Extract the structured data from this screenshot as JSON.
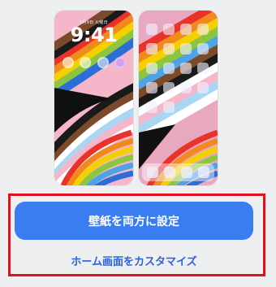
{
  "lock_screen": {
    "date": "1月9日 火曜日",
    "time": "9:41",
    "widgets": [
      "widget-circle",
      "widget-circle",
      "widget-circle",
      "widget-circle"
    ]
  },
  "home_screen": {
    "grid_rows": 5,
    "dock_apps": 4
  },
  "actions": {
    "set_both_label": "壁紙を両方に設定",
    "customize_home_label": "ホーム画面をカスタマイズ"
  },
  "colors": {
    "primary_button": "#3a7df1",
    "link_text": "#2d63d8",
    "highlight_border": "#e2101d",
    "background": "#eeeff1",
    "wallpaper_stripes": [
      "#4da3e3",
      "#2b6fd6",
      "#8cc63f",
      "#f5d000",
      "#f08a1c",
      "#e8322a",
      "#1a1a1a",
      "#7a4a2a",
      "#f4b6c8",
      "#a9d6f2",
      "#ffffff"
    ]
  }
}
